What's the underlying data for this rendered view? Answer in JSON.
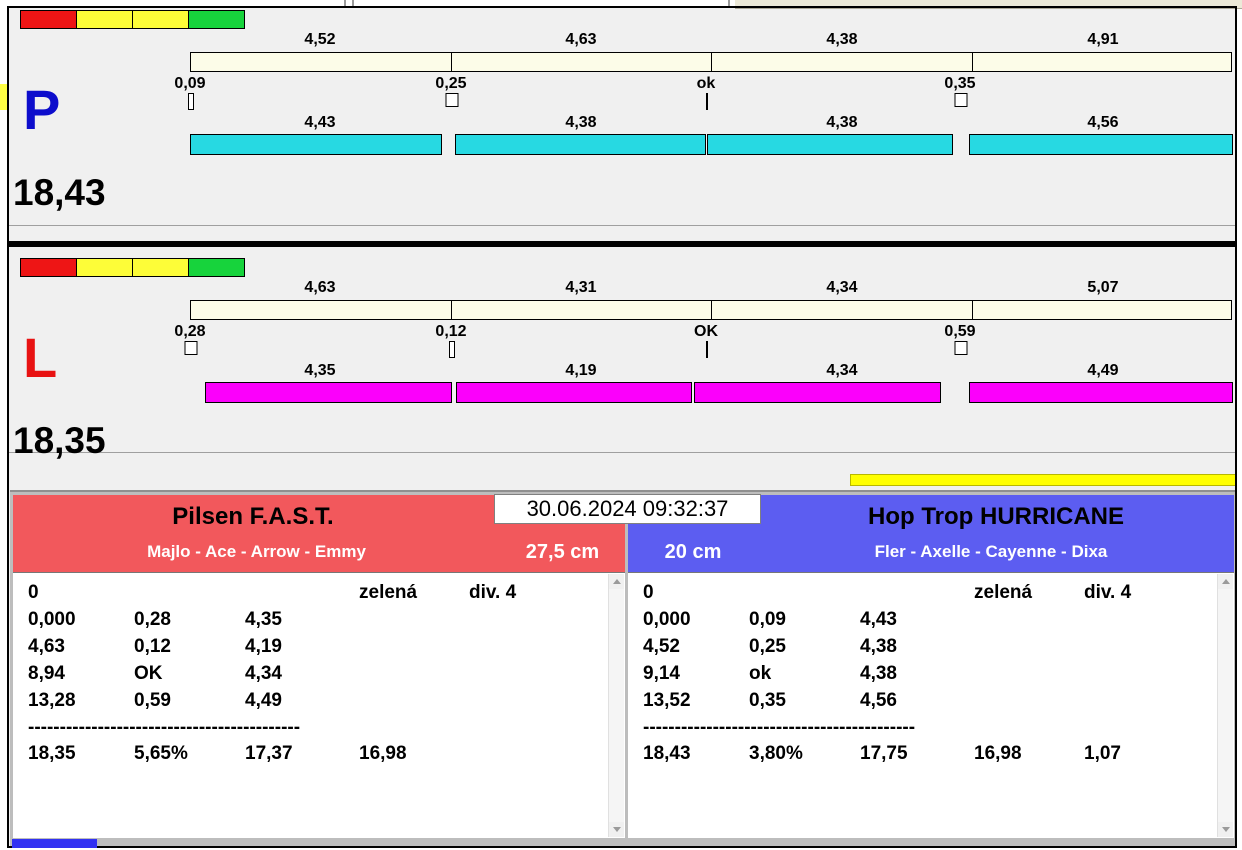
{
  "window": {
    "datetime": "30.06.2024 09:32:37"
  },
  "lanes": [
    {
      "id": "P",
      "letter": "P",
      "total": "18,43",
      "lights": [
        "red",
        "yellow",
        "yellow",
        "green"
      ],
      "split_times": [
        "4,52",
        "4,63",
        "4,38",
        "4,91"
      ],
      "change_times": [
        "0,09",
        "0,25",
        "ok",
        "0,35"
      ],
      "run_times": [
        "4,43",
        "4,38",
        "4,38",
        "4,56"
      ],
      "markers": [
        "bar",
        "box",
        "line",
        "box"
      ],
      "colors": {
        "letter": "#0d0dcc",
        "run_bar": "#27d9e2"
      }
    },
    {
      "id": "L",
      "letter": "L",
      "total": "18,35",
      "lights": [
        "red",
        "yellow",
        "yellow",
        "green"
      ],
      "split_times": [
        "4,63",
        "4,31",
        "4,34",
        "5,07"
      ],
      "change_times": [
        "0,28",
        "0,12",
        "OK",
        "0,59"
      ],
      "run_times": [
        "4,35",
        "4,19",
        "4,34",
        "4,49"
      ],
      "markers": [
        "box",
        "bar",
        "line",
        "box"
      ],
      "colors": {
        "letter": "#e81212",
        "run_bar": "#fb00fb"
      }
    }
  ],
  "teams": [
    {
      "name": "Pilsen F.A.S.T.",
      "members": "Majlo - Ace - Arrow - Emmy",
      "jump_height": "27,5 cm",
      "header_color": "#f2585c",
      "rows": [
        [
          "0",
          "",
          "",
          "zelená",
          "div. 4"
        ],
        [
          "0,000",
          "0,28",
          "4,35",
          "",
          ""
        ],
        [
          "4,63",
          "0,12",
          "4,19",
          "",
          ""
        ],
        [
          "8,94",
          "OK",
          "4,34",
          "",
          ""
        ],
        [
          "13,28",
          "0,59",
          "4,49",
          "",
          ""
        ]
      ],
      "separator": "-------------------------------------------",
      "summary": [
        "18,35",
        "5,65%",
        "17,37",
        "16,98",
        ""
      ]
    },
    {
      "name": "Hop Trop HURRICANE",
      "members": "Fler - Axelle - Cayenne - Dixa",
      "jump_height": "20 cm",
      "header_color": "#5c5df1",
      "rows": [
        [
          "0",
          "",
          "",
          "zelená",
          "div. 4"
        ],
        [
          "0,000",
          "0,09",
          "4,43",
          "",
          ""
        ],
        [
          "4,52",
          "0,25",
          "4,38",
          "",
          ""
        ],
        [
          "9,14",
          "ok",
          "4,38",
          "",
          ""
        ],
        [
          "13,52",
          "0,35",
          "4,56",
          "",
          ""
        ]
      ],
      "separator": "-------------------------------------------",
      "summary": [
        "18,43",
        "3,80%",
        "17,75",
        "16,98",
        "1,07"
      ]
    }
  ]
}
